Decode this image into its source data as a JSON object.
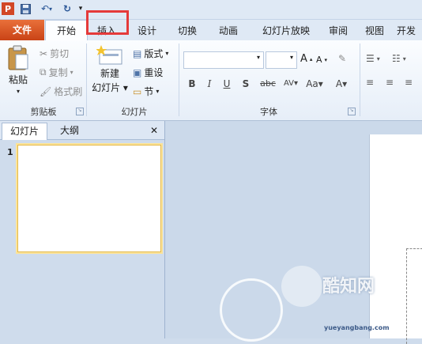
{
  "qat": {
    "app_icon": "powerpoint-icon",
    "save_icon": "save-icon",
    "undo_icon": "undo-icon",
    "redo_icon": "redo-icon",
    "customize_icon": "customize-icon"
  },
  "tabs": [
    "文件",
    "开始",
    "插入",
    "设计",
    "切换",
    "动画",
    "幻灯片放映",
    "审阅",
    "视图",
    "开发"
  ],
  "ribbon": {
    "clipboard": {
      "paste": "粘贴",
      "cut": "剪切",
      "copy": "复制",
      "format_painter": "格式刷",
      "group": "剪贴板"
    },
    "slides": {
      "new_slide_1": "新建",
      "new_slide_2": "幻灯片",
      "layout": "版式",
      "reset": "重设",
      "section": "节",
      "group": "幻灯片"
    },
    "font": {
      "group": "字体",
      "bold": "B",
      "italic": "I",
      "underline": "U",
      "shadow": "S",
      "strike": "abc",
      "spacing": "AV",
      "case": "Aa",
      "color": "A",
      "grow": "A",
      "shrink": "A"
    }
  },
  "panel": {
    "tab_slides": "幻灯片",
    "tab_outline": "大纲",
    "close": "✕",
    "slide_number": "1"
  },
  "watermark": {
    "brand": "酷知网",
    "site": "yueyangbang.com"
  }
}
